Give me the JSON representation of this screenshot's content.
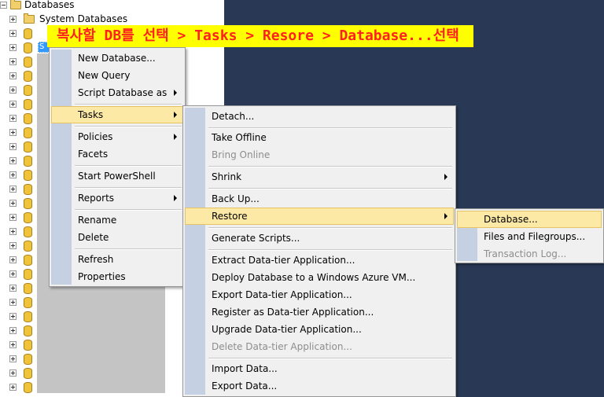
{
  "tree": {
    "root_label": "Databases",
    "system_databases_label": "System Databases",
    "selected_node_label": "S",
    "database_row_count": 26
  },
  "banner": {
    "text": "복사할 DB를 선택 > Tasks > Resore > Database...선택"
  },
  "context_menu": {
    "items": [
      {
        "label": "New Database..."
      },
      {
        "label": "New Query"
      },
      {
        "label": "Script Database as"
      },
      {
        "label": "Tasks"
      },
      {
        "label": "Policies"
      },
      {
        "label": "Facets"
      },
      {
        "label": "Start PowerShell"
      },
      {
        "label": "Reports"
      },
      {
        "label": "Rename"
      },
      {
        "label": "Delete"
      },
      {
        "label": "Refresh"
      },
      {
        "label": "Properties"
      }
    ]
  },
  "tasks_menu": {
    "items": [
      {
        "label": "Detach..."
      },
      {
        "label": "Take Offline"
      },
      {
        "label": "Bring Online"
      },
      {
        "label": "Shrink"
      },
      {
        "label": "Back Up..."
      },
      {
        "label": "Restore"
      },
      {
        "label": "Generate Scripts..."
      },
      {
        "label": "Extract Data-tier Application..."
      },
      {
        "label": "Deploy Database to a Windows Azure VM..."
      },
      {
        "label": "Export Data-tier Application..."
      },
      {
        "label": "Register as Data-tier Application..."
      },
      {
        "label": "Upgrade Data-tier Application..."
      },
      {
        "label": "Delete Data-tier Application..."
      },
      {
        "label": "Import Data..."
      },
      {
        "label": "Export Data..."
      }
    ]
  },
  "restore_menu": {
    "items": [
      {
        "label": "Database..."
      },
      {
        "label": "Files and Filegroups..."
      },
      {
        "label": "Transaction Log..."
      }
    ]
  },
  "colors": {
    "dark_pane": "#293955",
    "highlight": "#fde9a6",
    "banner_bg": "#ffff00",
    "banner_text": "#ff2020"
  }
}
